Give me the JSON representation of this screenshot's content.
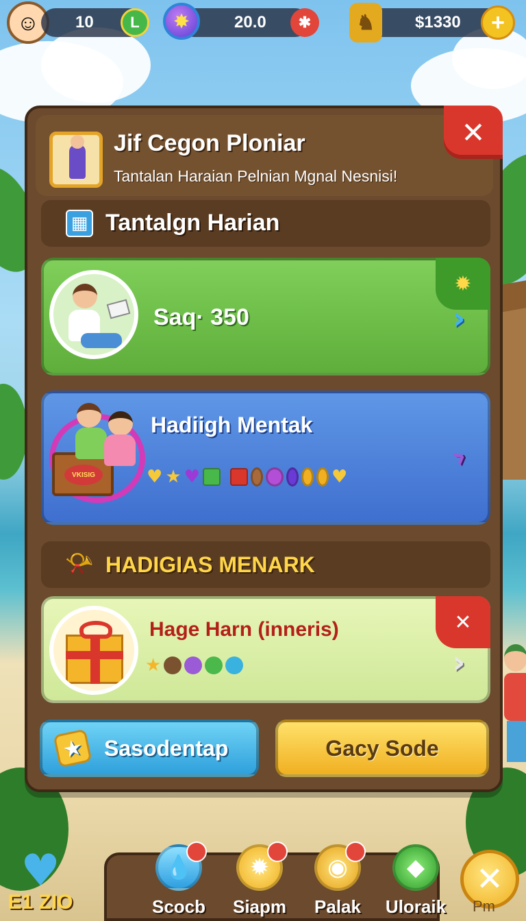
{
  "hud": {
    "avatar_icon": "player-avatar",
    "level_value": "10",
    "level_badge": "L",
    "gem_icon": "gem-icon",
    "energy_value": "20.0",
    "trophy_icon": "trophy-icon",
    "coins_value": "$1330",
    "add_currency_icon": "plus-icon"
  },
  "panel": {
    "title": "Jif Cegon Ploniar",
    "subtitle": "Tantalan Haraian Pelnian Mgnal Nesnisi!",
    "close_label": "✕",
    "section1_title": "Tantalgn Harian",
    "challenge_card": {
      "text": "Saq· 350",
      "arrow": "›"
    },
    "reward_card": {
      "title": "Hadiigh Mentak",
      "chest_label": "VKISIG",
      "arrow": "›"
    },
    "section2_title": "HADIGIAS MENARK",
    "gift_card": {
      "title": "Hage Harn (inneris)",
      "close_label": "✕",
      "arrow": "›"
    },
    "buttons": {
      "primary_label": "Sasodentap",
      "secondary_label": "Gacy Sode"
    }
  },
  "bottom_nav": {
    "heart_label": "E1 ZIO",
    "items": [
      {
        "label": "Scocb",
        "icon": "water-drop-icon"
      },
      {
        "label": "Siapm",
        "icon": "coin-icon"
      },
      {
        "label": "Palak",
        "icon": "bag-icon"
      },
      {
        "label": "Uloraik",
        "icon": "crystal-icon"
      }
    ],
    "close_label": "Pm"
  },
  "colors": {
    "panel": "#6b4a2e",
    "green_card": "#6cbf4a",
    "blue_card": "#4f83dc",
    "lime_card": "#dcefa8",
    "accent_gold": "#f3c322",
    "close_red": "#d9372c"
  }
}
